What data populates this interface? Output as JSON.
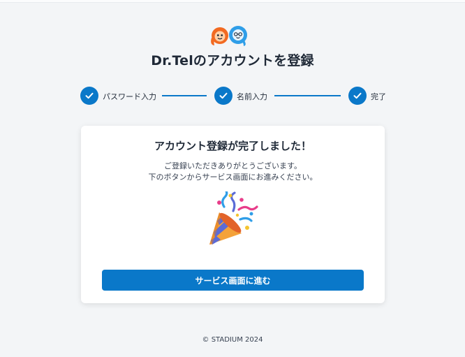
{
  "header": {
    "title": "Dr.Telのアカウントを登録",
    "logo_icon": "dr-tel-logo"
  },
  "steps": [
    {
      "label": "パスワード入力",
      "status": "complete"
    },
    {
      "label": "名前入力",
      "status": "complete"
    },
    {
      "label": "完了",
      "status": "complete"
    }
  ],
  "card": {
    "title": "アカウント登録が完了しました！",
    "message_line1": "ご登録いただきありがとうございます。",
    "message_line2": "下のボタンからサービス画面にお進みください。",
    "illustration": "party-popper-icon",
    "button_label": "サービス画面に進む"
  },
  "footer": {
    "copyright": "© STADIUM 2024"
  },
  "colors": {
    "accent": "#0a78c9",
    "background": "#f3f5f7",
    "card": "#ffffff",
    "logo_orange": "#f26a21",
    "logo_blue": "#2f9ee8"
  }
}
